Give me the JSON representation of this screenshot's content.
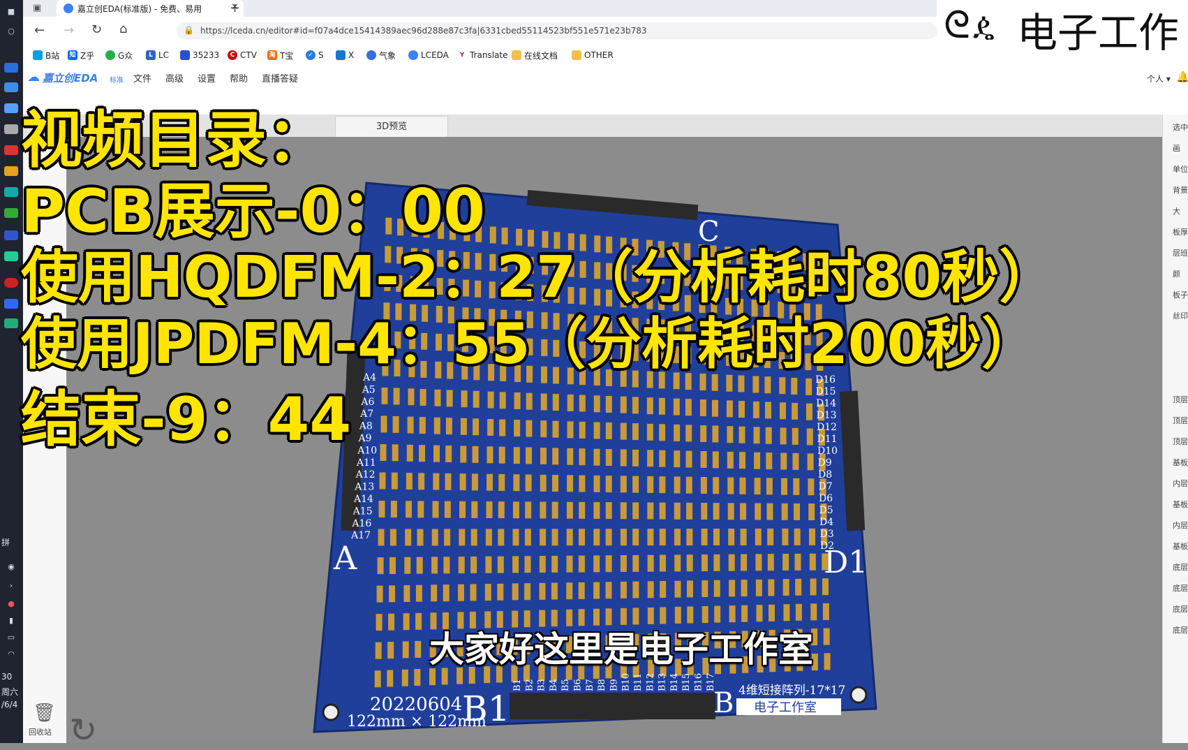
{
  "browser": {
    "tab_title": "嘉立创EDA(标准版) - 免费、易用",
    "url": "https://lceda.cn/editor#id=f07a4dce15414389aec96d288e87c3fa|6331cbed55114523bf551e571e23b783",
    "bookmarks": [
      "B站",
      "Z乎",
      "G众",
      "LC",
      "35233",
      "CTV",
      "T宝",
      "S",
      "X",
      "气象",
      "LCEDA",
      "Translate",
      "在线文档",
      "OTHER"
    ]
  },
  "app": {
    "logo": "嘉立创EDA",
    "logo_sub": "标准",
    "menus": [
      "文件",
      "高级",
      "设置",
      "帮助",
      "直播答疑"
    ],
    "user_menu": "个人"
  },
  "doc_tabs": {
    "preview_3d": "3D预览"
  },
  "left_panel": {
    "trash_label": "回收站"
  },
  "right_panel": {
    "items": [
      "选中",
      "画",
      "单位",
      "背景",
      "大",
      "板厚",
      "层班",
      "颜",
      "板子",
      "丝印",
      "",
      "顶层",
      "顶层",
      "顶层",
      "基板",
      "内层",
      "基板",
      "内层",
      "基板",
      "底层",
      "底层",
      "底层",
      "底层"
    ]
  },
  "taskbar": {
    "time": "30",
    "weekday": "周六",
    "date": "/6/4",
    "lang": "拼"
  },
  "overlay": {
    "lines": [
      "视频目录：",
      "PCB展示-0：00",
      "使用HQDFM-2：27（分析耗时80秒）",
      "使用JPDFM-4：55（分析耗时200秒）",
      "结束-9：44"
    ],
    "subtitle": "大家好这里是电子工作室"
  },
  "watermark": {
    "text": "电子工作"
  },
  "pcb": {
    "corner_labels": {
      "a": "A",
      "b": "B",
      "c": "C",
      "b1": "B1",
      "d1": "D1"
    },
    "date_text": "20220604",
    "size_text": "122mm × 122mm",
    "array_text": "4维短接阵列-17*17",
    "studio_text": "电子工作室",
    "row_labels_left": [
      "A4",
      "A5",
      "A6",
      "A7",
      "A8",
      "A9",
      "A10",
      "A11",
      "A12",
      "A13",
      "A14",
      "A15",
      "A16",
      "A17"
    ],
    "row_labels_right": [
      "D16",
      "D15",
      "D14",
      "D13",
      "D12",
      "D11",
      "D10",
      "D9",
      "D8",
      "D7",
      "D6",
      "D5",
      "D4",
      "D3",
      "D2"
    ],
    "col_labels_bottom": [
      "B1",
      "B2",
      "B3",
      "B4",
      "B5",
      "B6",
      "B7",
      "B8",
      "B9",
      "B10",
      "B11",
      "B12",
      "B13",
      "B14",
      "B15",
      "B16",
      "B17"
    ],
    "grid_size": 17,
    "colors": {
      "board": "#1f3f9a",
      "pad": "#c99a3a",
      "silk": "#ffffff"
    }
  }
}
